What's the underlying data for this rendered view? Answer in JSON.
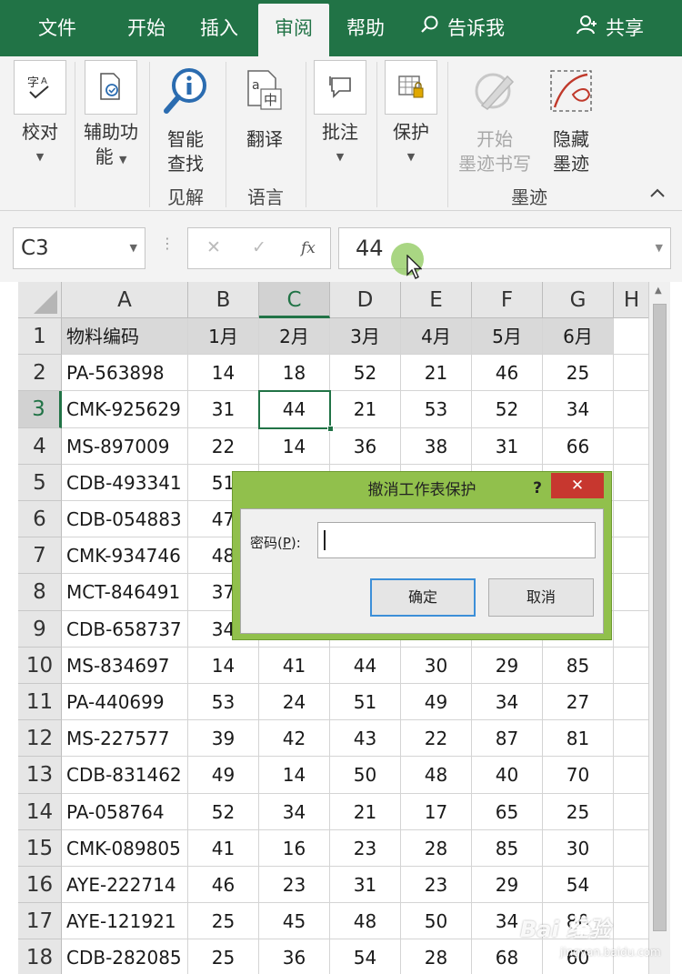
{
  "menu": {
    "tabs": [
      "文件",
      "开始",
      "插入",
      "审阅",
      "帮助"
    ],
    "active_tab": "审阅",
    "tell_me": "告诉我",
    "share": "共享"
  },
  "ribbon": {
    "buttons": {
      "proofing": "校对",
      "accessibility_1": "辅助功",
      "accessibility_2": "能",
      "smart_lookup_1": "智能",
      "smart_lookup_2": "查找",
      "translate": "翻译",
      "comments": "批注",
      "protect": "保护",
      "start_inking_1": "开始",
      "start_inking_2": "墨迹书写",
      "hide_ink_1": "隐藏",
      "hide_ink_2": "墨迹"
    },
    "groups": {
      "insights": "见解",
      "language": "语言",
      "ink": "墨迹"
    }
  },
  "formula_bar": {
    "name_box": "C3",
    "value": "44",
    "fx": "fx"
  },
  "sheet": {
    "columns": [
      "A",
      "B",
      "C",
      "D",
      "E",
      "F",
      "G",
      "H"
    ],
    "selected_column": "C",
    "selected_row": "3",
    "header_row": [
      "物料编码",
      "1月",
      "2月",
      "3月",
      "4月",
      "5月",
      "6月"
    ],
    "row_numbers": [
      "1",
      "2",
      "3",
      "4",
      "5",
      "6",
      "7",
      "8",
      "9",
      "10",
      "11",
      "12",
      "13",
      "14",
      "15",
      "16",
      "17",
      "18"
    ],
    "rows": [
      [
        "PA-563898",
        "14",
        "18",
        "52",
        "21",
        "46",
        "25"
      ],
      [
        "CMK-925629",
        "31",
        "44",
        "21",
        "53",
        "52",
        "34"
      ],
      [
        "MS-897009",
        "22",
        "14",
        "36",
        "38",
        "31",
        "66"
      ],
      [
        "CDB-493341",
        "51",
        "",
        "",
        "",
        "",
        ""
      ],
      [
        "CDB-054883",
        "47",
        "",
        "",
        "",
        "",
        ""
      ],
      [
        "CMK-934746",
        "48",
        "",
        "",
        "",
        "",
        ""
      ],
      [
        "MCT-846491",
        "37",
        "",
        "",
        "",
        "",
        ""
      ],
      [
        "CDB-658737",
        "34",
        "",
        "",
        "",
        "",
        ""
      ],
      [
        "MS-834697",
        "14",
        "41",
        "44",
        "30",
        "29",
        "85"
      ],
      [
        "PA-440699",
        "53",
        "24",
        "51",
        "49",
        "34",
        "27"
      ],
      [
        "MS-227577",
        "39",
        "42",
        "43",
        "22",
        "87",
        "81"
      ],
      [
        "CDB-831462",
        "49",
        "14",
        "50",
        "48",
        "40",
        "70"
      ],
      [
        "PA-058764",
        "52",
        "34",
        "21",
        "17",
        "65",
        "25"
      ],
      [
        "CMK-089805",
        "41",
        "16",
        "23",
        "28",
        "85",
        "30"
      ],
      [
        "AYE-222714",
        "46",
        "23",
        "31",
        "23",
        "29",
        "54"
      ],
      [
        "AYE-121921",
        "25",
        "45",
        "48",
        "50",
        "34",
        "80"
      ],
      [
        "CDB-282085",
        "25",
        "36",
        "54",
        "28",
        "68",
        "60"
      ]
    ]
  },
  "dialog": {
    "title": "撤消工作表保护",
    "help": "?",
    "close": "✕",
    "password_label": "密码(",
    "password_key": "P",
    "password_label_end": "):",
    "password_value": "",
    "ok": "确定",
    "cancel": "取消"
  },
  "watermark": {
    "brand": "Bai  经验",
    "site": "jingyan.baidu.com"
  },
  "colors": {
    "excel_green": "#217346",
    "dialog_frame": "#91c04c",
    "close_red": "#c7372f"
  }
}
